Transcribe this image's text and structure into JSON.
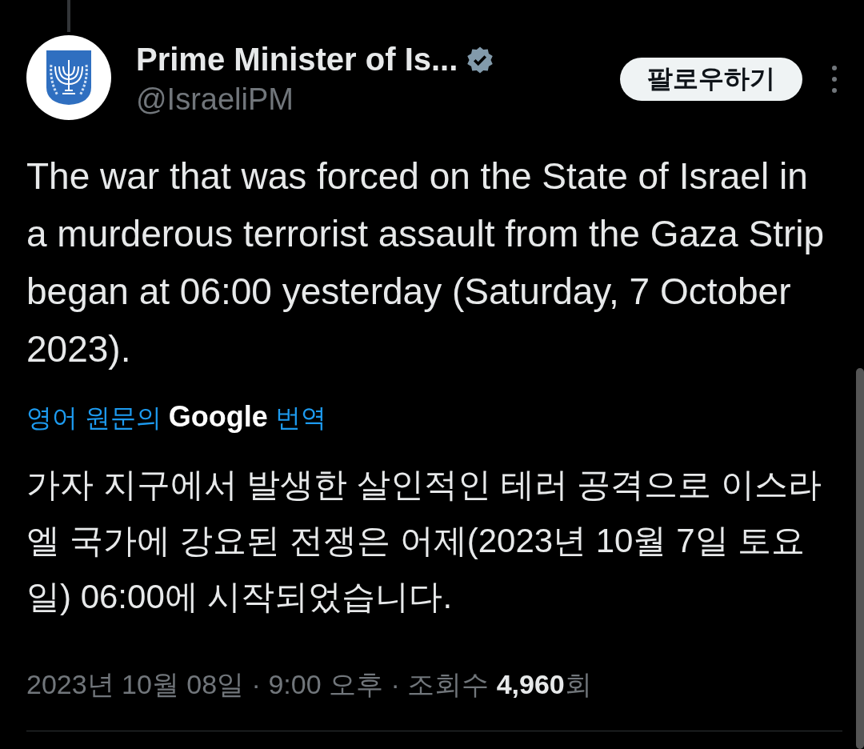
{
  "author": {
    "name": "Prime Minister of Is...",
    "verified": true,
    "handle": "@IsraeliPM"
  },
  "follow_button": "팔로우하기",
  "tweet_text": "The war that was forced on the State of Israel in a murderous terrorist assault from the Gaza Strip began at 06:00 yesterday (Saturday, 7 October 2023).",
  "translation": {
    "prefix": "영어 원문의",
    "brand": "Google",
    "suffix": "번역"
  },
  "translated_text": "가자 지구에서 발생한 살인적인 테러 공격으로 이스라엘 국가에 강요된 전쟁은 어제(2023년 10월 7일 토요일) 06:00에 시작되었습니다.",
  "meta": "2023년 10월 08일 · 9:00 오후 · 조회수 **4,960**회"
}
